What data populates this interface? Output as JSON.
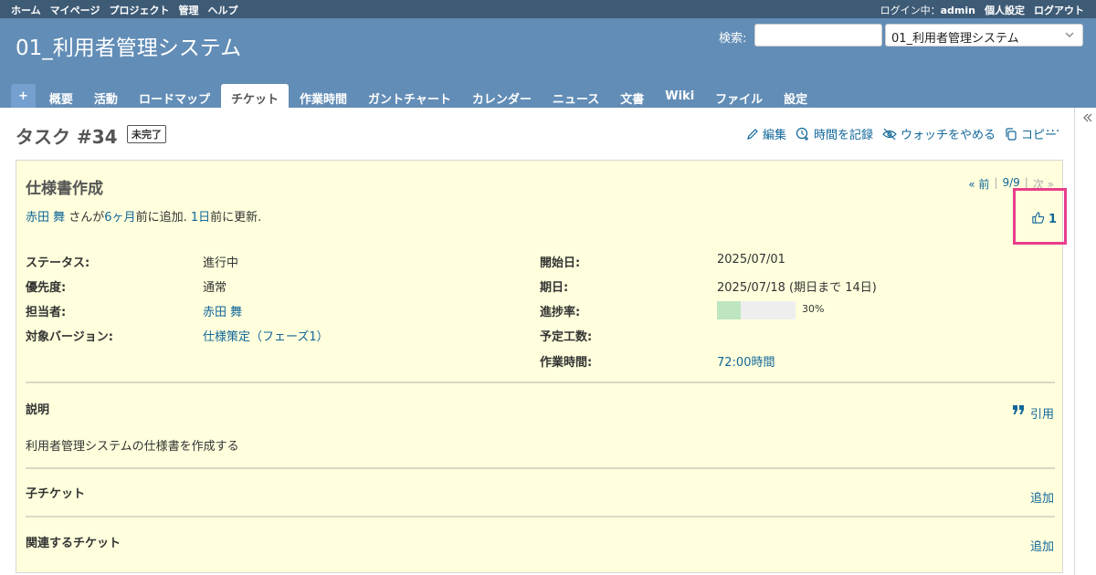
{
  "top_menu": {
    "left": [
      "ホーム",
      "マイページ",
      "プロジェクト",
      "管理",
      "ヘルプ"
    ],
    "logged_in_label": "ログイン中：",
    "user": "admin",
    "my_account": "個人設定",
    "logout": "ログアウト"
  },
  "header": {
    "project_title": "01_利用者管理システム",
    "search_label": "検索:",
    "search_value": "",
    "project_jump": "01_利用者管理システム"
  },
  "main_menu": {
    "new_label": "+",
    "tabs": [
      "概要",
      "活動",
      "ロードマップ",
      "チケット",
      "作業時間",
      "ガントチャート",
      "カレンダー",
      "ニュース",
      "文書",
      "Wiki",
      "ファイル",
      "設定"
    ],
    "selected": "チケット"
  },
  "issue": {
    "heading": "タスク #34",
    "status_badge": "未完了",
    "actions": {
      "edit": "編集",
      "log_time": "時間を記録",
      "unwatch": "ウォッチをやめる",
      "copy": "コピー",
      "more": "···"
    },
    "subject": "仕様書作成",
    "prevnext": {
      "prev": "« 前",
      "sep": "|",
      "position": "9/9",
      "next": "次 »"
    },
    "author_line": {
      "author": "赤田 舞",
      "text1": " さんが",
      "added": "6ヶ月",
      "text2": "前に追加. ",
      "updated": "1日",
      "text3": "前に更新."
    },
    "reaction_count": "1",
    "attributes_left": [
      {
        "label": "ステータス:",
        "value": "進行中",
        "link": false
      },
      {
        "label": "優先度:",
        "value": "通常",
        "link": false
      },
      {
        "label": "担当者:",
        "value": "赤田 舞",
        "link": true
      },
      {
        "label": "対象バージョン:",
        "value": "仕様策定（フェーズ1）",
        "link": true
      }
    ],
    "attributes_right": [
      {
        "label": "開始日:",
        "value": "2025/07/01",
        "link": false
      },
      {
        "label": "期日:",
        "value": "2025/07/18 (期日まで 14日)",
        "link": false
      },
      {
        "label": "進捗率:",
        "value": "",
        "link": false
      },
      {
        "label": "予定工数:",
        "value": "",
        "link": false
      },
      {
        "label": "作業時間:",
        "value": "72:00時間",
        "link": true
      }
    ],
    "progress": {
      "percent": 30,
      "text": "30%"
    },
    "description": {
      "title": "説明",
      "quote": "引用",
      "text": "利用者管理システムの仕様書を作成する"
    },
    "subtasks": {
      "title": "子チケット",
      "add": "追加"
    },
    "relations": {
      "title": "関連するチケット",
      "add": "追加"
    }
  },
  "colors": {
    "link": "#116699",
    "header_bg": "#628db6",
    "top_bar": "#3e5b76",
    "issue_bg": "#ffffdd",
    "highlight": "#e83e8c",
    "progress_done": "#bde5c0"
  }
}
